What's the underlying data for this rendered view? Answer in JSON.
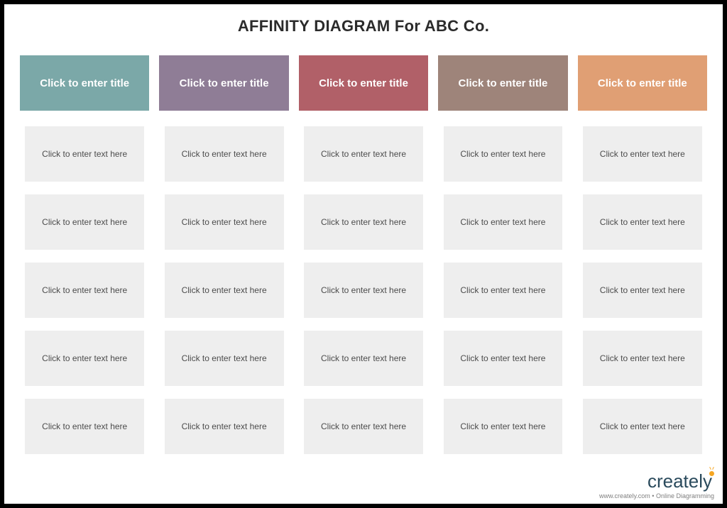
{
  "title": "AFFINITY DIAGRAM For ABC Co.",
  "columns": [
    {
      "header": "Click to enter title",
      "color": "#7ba8a8",
      "cards": [
        "Click to enter text here",
        "Click to enter text here",
        "Click to enter text here",
        "Click to enter text here",
        "Click to enter text here"
      ]
    },
    {
      "header": "Click to enter title",
      "color": "#8f7d96",
      "cards": [
        "Click to enter text here",
        "Click to enter text here",
        "Click to enter text here",
        "Click to enter text here",
        "Click to enter text here"
      ]
    },
    {
      "header": "Click to enter title",
      "color": "#b16068",
      "cards": [
        "Click to enter text here",
        "Click to enter text here",
        "Click to enter text here",
        "Click to enter text here",
        "Click to enter text here"
      ]
    },
    {
      "header": "Click to enter title",
      "color": "#9e847a",
      "cards": [
        "Click to enter text here",
        "Click to enter text here",
        "Click to enter text here",
        "Click to enter text here",
        "Click to enter text here"
      ]
    },
    {
      "header": "Click to enter title",
      "color": "#e09f74",
      "cards": [
        "Click to enter text here",
        "Click to enter text here",
        "Click to enter text here",
        "Click to enter text here",
        "Click to enter text here"
      ]
    }
  ],
  "footer": {
    "logo_text": "creately",
    "tagline": "www.creately.com • Online Diagramming"
  }
}
